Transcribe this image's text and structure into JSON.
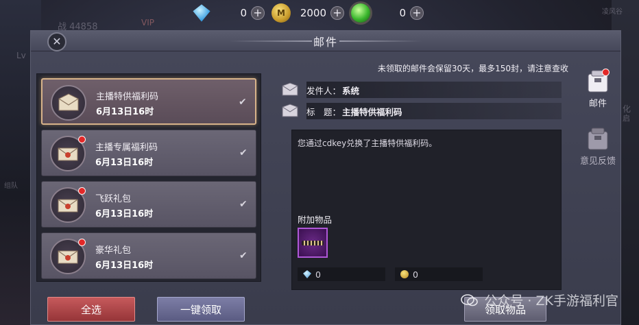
{
  "currencies": [
    {
      "icon": "diamond-icon",
      "value": "0"
    },
    {
      "icon": "gold-coin-icon",
      "symbol": "M",
      "value": "2000"
    },
    {
      "icon": "green-orb-icon",
      "value": "0"
    }
  ],
  "background": {
    "battle_power": "战 44858",
    "vip": "VIP",
    "lv": "Lv",
    "team": "组队",
    "right_top": "凌风谷",
    "right_mid1": "化",
    "right_mid2": "启"
  },
  "window": {
    "title": "邮件",
    "notice": "未领取的邮件会保留30天，最多150封，请注意查收"
  },
  "mails": [
    {
      "name": "主播特供福利码",
      "date": "6月13日16时",
      "selected": true,
      "unread": false,
      "checked": "✔"
    },
    {
      "name": "主播专属福利码",
      "date": "6月13日16时",
      "selected": false,
      "unread": true,
      "checked": "✔"
    },
    {
      "name": "飞跃礼包",
      "date": "6月13日16时",
      "selected": false,
      "unread": true,
      "checked": "✔"
    },
    {
      "name": "豪华礼包",
      "date": "6月13日16时",
      "selected": false,
      "unread": true,
      "checked": "✔"
    }
  ],
  "detail": {
    "sender_label": "发件人：",
    "sender": "系统",
    "subject_label": "标　题：",
    "subject": "主播特供福利码",
    "message": "您通过cdkey兑换了主播特供福利码。",
    "attachments_title": "附加物品",
    "diamond_amount": "0",
    "coin_amount": "0"
  },
  "buttons": {
    "select_all": "全选",
    "claim_all": "一键领取",
    "claim_items": "领取物品"
  },
  "side_tabs": [
    {
      "label": "邮件",
      "icon": "mailbox-icon",
      "badge": true
    },
    {
      "label": "意见反馈",
      "icon": "feedback-box-icon",
      "badge": false
    }
  ],
  "watermark": "公众号 · ZK手游福利官",
  "colors": {
    "select_all": "#b8474a",
    "claim_all": "#6b6c94",
    "selection_border": "#d8b38a",
    "unread_dot": "#e22828"
  }
}
